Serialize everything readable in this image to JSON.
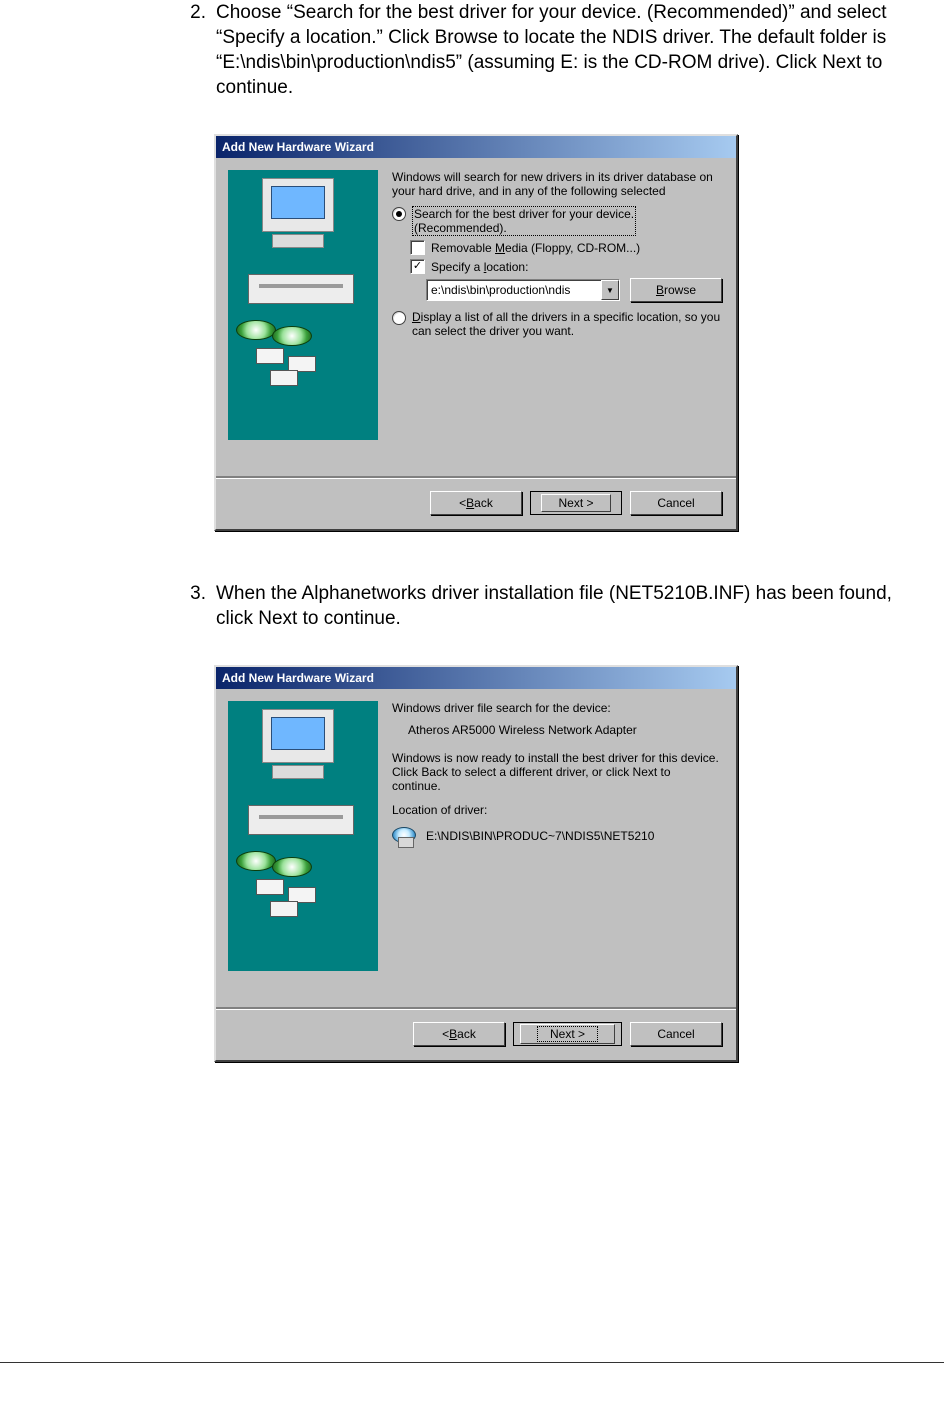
{
  "steps": {
    "s2": {
      "num": "2.",
      "text": "Choose “Search for the best driver for your device. (Recommended)” and select “Specify a location.” Click Browse to locate the NDIS driver. The default folder is “E:\\ndis\\bin\\production\\ndis5” (assuming E: is the CD-ROM drive). Click Next to continue."
    },
    "s3": {
      "num": "3.",
      "text": "When the Alphanetworks driver installation file (NET5210B.INF) has been found, click Next to continue."
    }
  },
  "dlg1": {
    "title": "Add New Hardware Wizard",
    "intro": "Windows will search for new drivers in its driver database on your hard drive, and in any of the following selected",
    "r1a": "Search for the best driver for your device.",
    "r1b": "(Recommended).",
    "chk1_pre": "Removable ",
    "chk1_u": "M",
    "chk1_post": "edia (Floppy, CD-ROM...)",
    "chk2_pre": "Specify a ",
    "chk2_u": "l",
    "chk2_post": "ocation:",
    "path": "e:\\ndis\\bin\\production\\ndis",
    "browse_u": "B",
    "browse_post": "rowse",
    "r2_u": "D",
    "r2_post": "isplay a list of all the drivers in a specific location, so you can select the driver you want.",
    "back_pre": "< ",
    "back_u": "B",
    "back_post": "ack",
    "next": "Next >",
    "cancel": "Cancel"
  },
  "dlg2": {
    "title": "Add New Hardware Wizard",
    "l1": "Windows driver file search for the device:",
    "dev": "Atheros AR5000 Wireless Network Adapter",
    "l2": "Windows is now ready to install the best driver for this device. Click Back to select a different driver, or click Next to continue.",
    "loc_lbl": "Location of driver:",
    "loc": "E:\\NDIS\\BIN\\PRODUC~7\\NDIS5\\NET5210",
    "back_pre": "< ",
    "back_u": "B",
    "back_post": "ack",
    "next": "Next >",
    "cancel": "Cancel"
  }
}
